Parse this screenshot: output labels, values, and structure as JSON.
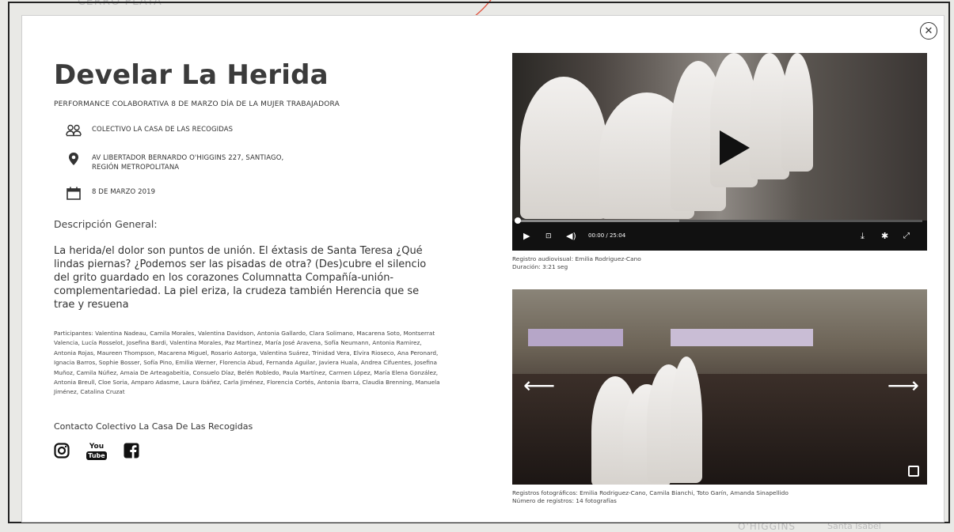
{
  "background": {
    "map_label_top": "CERRO PLATA",
    "map_label_bottom_1": "O'HIGGINS",
    "map_label_bottom_2": "Santa Isabel"
  },
  "modal": {
    "title": "Develar La Herida",
    "subtitle": "PERFORMANCE COLABORATIVA 8 DE MARZO DÍA DE LA MUJER TRABAJADORA",
    "meta": {
      "collective": "COLECTIVO LA CASA DE LAS RECOGIDAS",
      "address_line1": "AV LIBERTADOR BERNARDO O'HIGGINS 227, SANTIAGO,",
      "address_line2": "REGIÓN METROPOLITANA",
      "date": "8 DE MARZO 2019"
    },
    "description_heading": "Descripción General:",
    "description_body": "La herida/el dolor son puntos de unión. El éxtasis de Santa Teresa ¿Qué lindas piernas? ¿Podemos ser las pisadas de otra? (Des)cubre el silencio del grito guardado en los corazones Columnatta Compañía-unión-complementariedad. La piel eriza, la crudeza también  Herencia que se trae y resuena",
    "participants": "Participantes: Valentina Nadeau, Camila Morales, Valentina Davidson, Antonia Gallardo, Clara Solimano, Macarena Soto, Montserrat Valencia, Lucía Rosselot, Josefina Bardi, Valentina Morales, Paz Martinez, María José Aravena, Sofía Neumann, Antonia Ramirez, Antonia Rojas, Maureen Thompson, Macarena Miguel, Rosario Astorga, Valentina Suárez, Trinidad Vera, Elvira Rioseco, Ana Peronard, Ignacia Barros, Sophie Bosser, Sofía Pino, Emilia Werner, Florencia Abud, Fernanda Aguilar, Javiera Huala, Andrea Cifuentes, Josefina Muñoz, Camila Núñez, Amaia De Arteagabeitia, Consuelo Díaz, Belén Robledo, Paula Martínez, Carmen López, María Elena González, Antonia Breull, Cloe Soria, Amparo Adasme, Laura Ibáñez, Carla Jiménez, Florencia Cortés, Antonia Ibarra, Claudia Brenning, Manuela Jiménez, Catalina Cruzat",
    "contact": "Contacto Colectivo La Casa De Las Recogidas",
    "social": {
      "youtube_top": "You",
      "youtube_bottom": "Tube"
    },
    "video": {
      "time": "00:00 / 25:04",
      "progress": 0,
      "caption_line1": "Registro audiovisual: Emilia Rodriguez-Cano",
      "caption_line2": "Duración: 3:21 seg"
    },
    "gallery": {
      "caption_line1": "Registros fotográficos: Emilia Rodriguez-Cano, Camila Bianchi, Toto Garín, Amanda Sinapellido",
      "caption_line2": "Número de registros: 14 fotografías"
    }
  },
  "colors": {
    "accent_red": "#e0523f",
    "title": "#3b3b3b"
  },
  "icons": [
    "close-icon",
    "group-icon",
    "location-pin-icon",
    "calendar-icon",
    "instagram-icon",
    "youtube-icon",
    "facebook-icon",
    "play-icon",
    "subtitles-icon",
    "volume-icon",
    "download-icon",
    "settings-icon",
    "fullscreen-icon",
    "arrow-left-icon",
    "arrow-right-icon"
  ]
}
